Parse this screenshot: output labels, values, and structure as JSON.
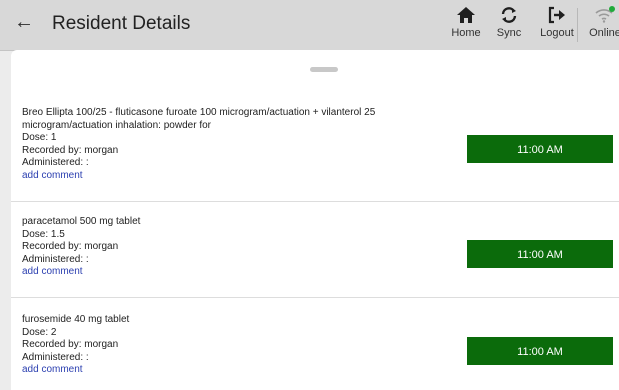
{
  "header": {
    "title": "Resident Details",
    "back_label": "←",
    "nav": {
      "home": "Home",
      "sync": "Sync",
      "logout": "Logout",
      "online": "Online"
    }
  },
  "colors": {
    "header_bg": "#d8d8d8",
    "time_button": "#0b6b0b",
    "link": "#2b3fb0",
    "online_dot": "#1faa3a"
  },
  "icons": {
    "back": "arrow-left-icon",
    "home": "home-icon",
    "sync": "sync-icon",
    "logout": "logout-icon",
    "online": "wifi-icon"
  },
  "medications": [
    {
      "name": "Breo Ellipta 100/25 - fluticasone furoate 100 microgram/actuation + vilanterol 25 microgram/actuation inhalation: powder for",
      "dose": "Dose: 1",
      "recorded_by": "Recorded by: morgan",
      "administered": "Administered: :",
      "comment_link": "add comment",
      "time": "11:00 AM"
    },
    {
      "name": "paracetamol 500 mg tablet",
      "dose": "Dose: 1.5",
      "recorded_by": "Recorded by: morgan",
      "administered": "Administered: :",
      "comment_link": "add comment",
      "time": "11:00 AM"
    },
    {
      "name": "furosemide 40 mg tablet",
      "dose": "Dose: 2",
      "recorded_by": "Recorded by: morgan",
      "administered": "Administered: :",
      "comment_link": "add comment",
      "time": "11:00 AM"
    }
  ]
}
